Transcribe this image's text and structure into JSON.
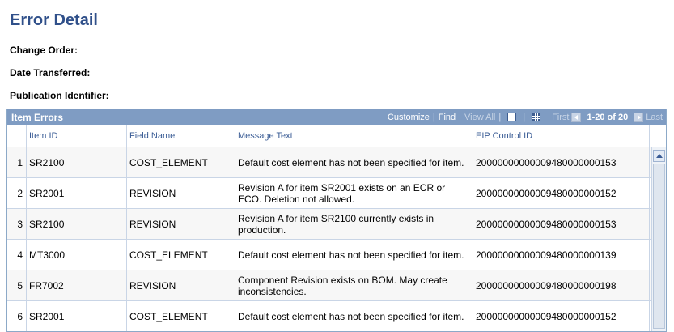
{
  "page": {
    "title": "Error Detail"
  },
  "fields": {
    "change_order_label": "Change Order:",
    "date_transferred_label": "Date Transferred:",
    "publication_identifier_label": "Publication Identifier:"
  },
  "grid": {
    "title": "Item Errors",
    "nav": {
      "customize": "Customize",
      "find": "Find",
      "view_all": "View All",
      "first": "First",
      "range": "1-20 of 20",
      "last": "Last"
    },
    "columns": [
      "",
      "Item ID",
      "Field Name",
      "Message Text",
      "EIP Control ID"
    ],
    "rows": [
      {
        "num": "1",
        "item_id": "SR2100",
        "field_name": "COST_ELEMENT",
        "message": "Default cost element has not been specified for item.",
        "eip_id": "20000000000009480000000153"
      },
      {
        "num": "2",
        "item_id": "SR2001",
        "field_name": "REVISION",
        "message": "Revision A for item SR2001 exists on an ECR or ECO.  Deletion not allowed.",
        "eip_id": "20000000000009480000000152"
      },
      {
        "num": "3",
        "item_id": "SR2100",
        "field_name": "REVISION",
        "message": "Revision A for item SR2100 currently exists in production.",
        "eip_id": "20000000000009480000000153"
      },
      {
        "num": "4",
        "item_id": "MT3000",
        "field_name": "COST_ELEMENT",
        "message": "Default cost element has not been specified for item.",
        "eip_id": "20000000000009480000000139"
      },
      {
        "num": "5",
        "item_id": "FR7002",
        "field_name": "REVISION",
        "message": "Component Revision exists on BOM. May create inconsistencies.",
        "eip_id": "20000000000009480000000198"
      },
      {
        "num": "6",
        "item_id": "SR2001",
        "field_name": "COST_ELEMENT",
        "message": "Default cost element has not been specified for item.",
        "eip_id": "20000000000009480000000152"
      }
    ]
  },
  "icons": {
    "zoom": "zoom-icon",
    "download": "grid-download-icon",
    "first_arrow": "arrow-left-icon",
    "last_arrow": "arrow-right-icon",
    "scroll_up": "scroll-up-icon"
  },
  "colors": {
    "title": "#30508a",
    "grid_header": "#7f9cc3",
    "column_header_text": "#3a5c95",
    "row_alt": "#f7f7f7"
  }
}
